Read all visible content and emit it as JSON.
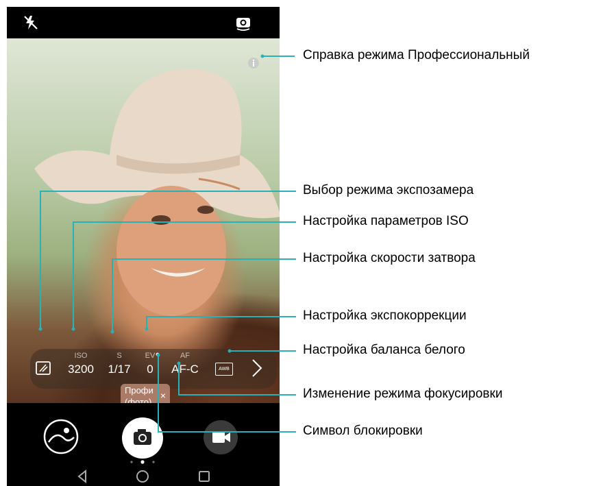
{
  "camera": {
    "controls": [
      {
        "label": "ISO",
        "value": "3200"
      },
      {
        "label": "S",
        "value": "1/17"
      },
      {
        "label": "EV",
        "value": "0"
      },
      {
        "label": "AF",
        "value": "AF-C"
      }
    ],
    "awb_label": "AWB",
    "mode_badge": {
      "line1": "Профи",
      "line2": "(фото)",
      "close": "×"
    }
  },
  "callouts": {
    "help": "Справка режима Профессиональный",
    "metering": "Выбор режима экспозамера",
    "iso": "Настройка параметров ISO",
    "shutter": "Настройка скорости затвора",
    "ev": "Настройка экспокоррекции",
    "wb": "Настройка баланса белого",
    "focus": "Изменение режима фокусировки",
    "lock": "Символ блокировки"
  },
  "colors": {
    "leader_line": "#2ab0b8",
    "phone_bg": "#000000"
  },
  "icons": [
    "flash-off-icon",
    "switch-camera-icon",
    "info-icon",
    "metering-icon",
    "awb-icon",
    "chevron-right-icon",
    "gallery-icon",
    "shutter-icon",
    "video-icon",
    "back-icon",
    "home-icon",
    "recents-icon"
  ]
}
